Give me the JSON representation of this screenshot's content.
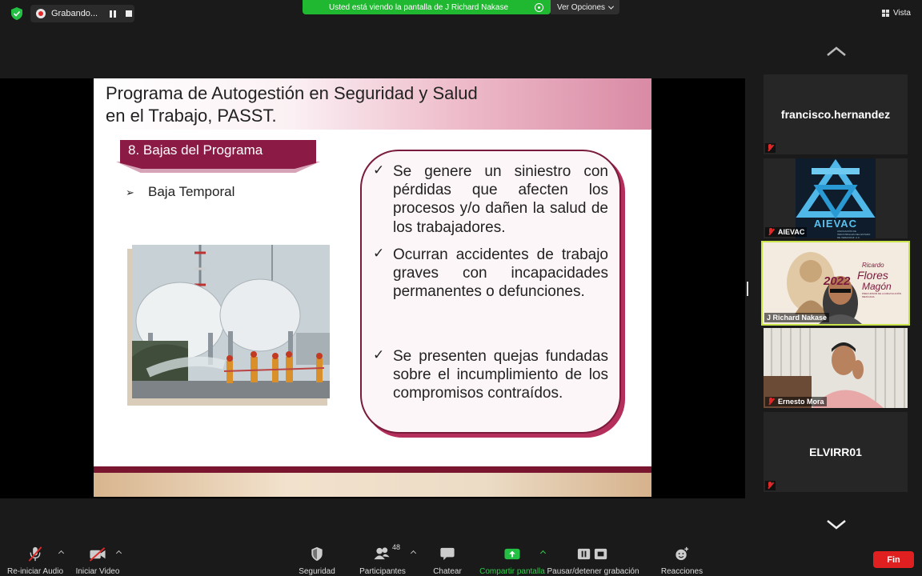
{
  "topbar": {
    "recording_label": "Grabando...",
    "share_banner": "Usted está viendo la pantalla de J Richard Nakase",
    "options_label": "Ver Opciones",
    "view_label": "Vista"
  },
  "slide": {
    "title_line1": "Programa de Autogestión en Seguridad y Salud",
    "title_line2": "en el Trabajo, PASST.",
    "section": "8. Bajas del Programa",
    "bullet": "Baja Temporal",
    "items": [
      "Se genere un siniestro con pérdidas que afecten los procesos y/o dañen la salud de los trabajadores.",
      "Ocurran accidentes de trabajo graves con incapacidades permanentes o defunciones.",
      "Se presenten quejas fundadas sobre el incumplimiento de los compromisos contraídos."
    ]
  },
  "participants": [
    {
      "name": "francisco.hernandez",
      "display": "francisco.hernandez"
    },
    {
      "name": "AIEVAC",
      "logo_text": "AIEVAC",
      "logo_subtext": "ASOCIACIÓN DE INDUSTRIALES DEL ESTADO DE VERACRUZ, A.C."
    },
    {
      "name": "J Richard Nakase",
      "banner_year": "2022",
      "banner_name1": "Ricardo",
      "banner_name2": "Flores",
      "banner_name3": "Magón",
      "banner_sub": "PRECURSOR DE LA REVOLUCIÓN MEXICANA"
    },
    {
      "name": "Ernesto Mora"
    },
    {
      "name": "ELVIRR01",
      "display": "ELVIRR01"
    }
  ],
  "toolbar": {
    "audio": "Re-iniciar Audio",
    "video": "Iniciar Video",
    "security": "Seguridad",
    "participants": "Participantes",
    "participant_count": "48",
    "chat": "Chatear",
    "share": "Compartir pantalla",
    "record": "Pausar/detener grabación",
    "reactions": "Reacciones",
    "end": "Fin"
  },
  "colors": {
    "slide_accent": "#8b1a44",
    "share_green": "#20b830",
    "end_red": "#e02020",
    "active_speaker": "#c9e34a"
  }
}
